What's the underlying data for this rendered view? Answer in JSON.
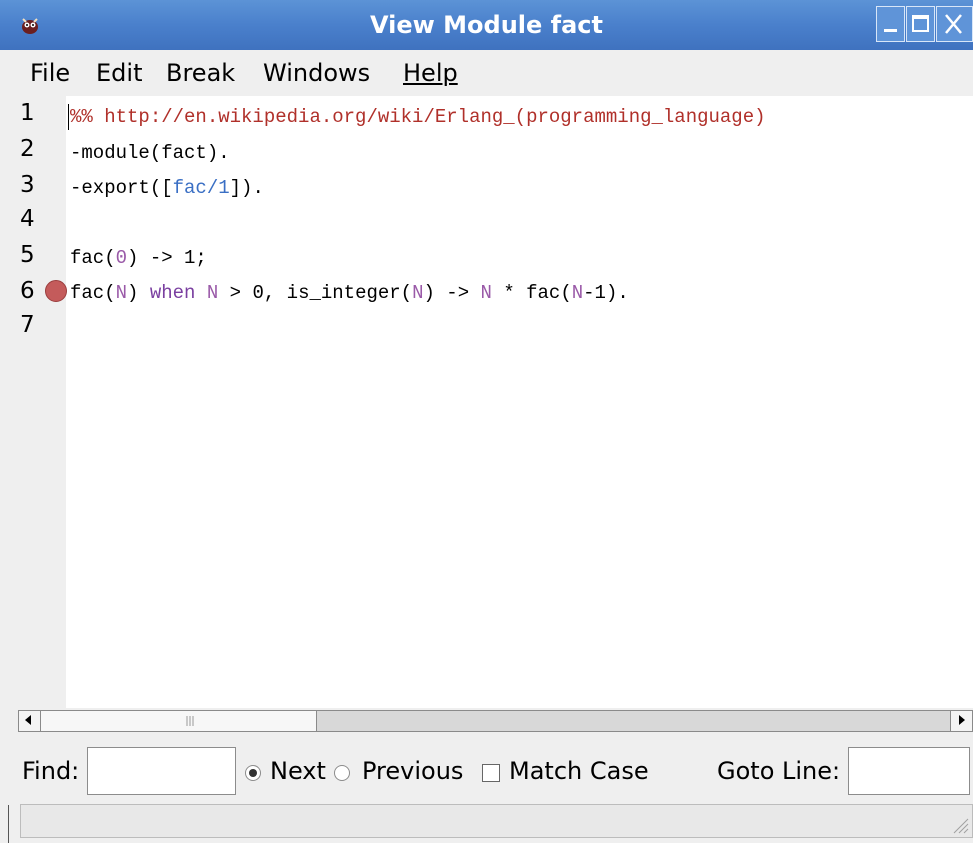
{
  "window": {
    "title": "View Module fact",
    "app_icon": "erlang-bug-icon",
    "controls": [
      "minimize-icon",
      "maximize-icon",
      "close-icon"
    ]
  },
  "menu": {
    "items": [
      "File",
      "Edit",
      "Break",
      "Windows",
      "Help"
    ]
  },
  "editor": {
    "line_numbers": [
      "1",
      "2",
      "3",
      "4",
      "5",
      "6",
      "7"
    ],
    "breakpoint_line": "6",
    "lines": [
      [
        {
          "t": "%% http://en.wikipedia.org/wiki/Erlang_(programming_language)",
          "c": "comment"
        }
      ],
      [
        {
          "t": "-module(fact).",
          "c": "plain"
        }
      ],
      [
        {
          "t": "-export([",
          "c": "plain"
        },
        {
          "t": "fac/1",
          "c": "atom"
        },
        {
          "t": "]).",
          "c": "plain"
        }
      ],
      [],
      [
        {
          "t": "fac(",
          "c": "plain"
        },
        {
          "t": "0",
          "c": "var"
        },
        {
          "t": ") -> 1;",
          "c": "plain"
        }
      ],
      [
        {
          "t": "fac(",
          "c": "plain"
        },
        {
          "t": "N",
          "c": "var"
        },
        {
          "t": ") ",
          "c": "plain"
        },
        {
          "t": "when",
          "c": "kw"
        },
        {
          "t": " ",
          "c": "plain"
        },
        {
          "t": "N",
          "c": "var"
        },
        {
          "t": " > 0, is_integer(",
          "c": "plain"
        },
        {
          "t": "N",
          "c": "var"
        },
        {
          "t": ") -> ",
          "c": "plain"
        },
        {
          "t": "N",
          "c": "var"
        },
        {
          "t": " * fac(",
          "c": "plain"
        },
        {
          "t": "N",
          "c": "var"
        },
        {
          "t": "-1).",
          "c": "plain"
        }
      ],
      []
    ],
    "colors": {
      "comment": "#b0302a",
      "var": "#9a5aa8",
      "kw": "#7a3fa0",
      "atom": "#3a6fc4",
      "breakpoint": "#c45b5b"
    }
  },
  "findbar": {
    "find_label": "Find:",
    "find_value": "",
    "next_label": "Next",
    "next_selected": true,
    "previous_label": "Previous",
    "previous_selected": false,
    "match_case_label": "Match Case",
    "match_case_checked": false,
    "goto_label": "Goto Line:",
    "goto_value": ""
  },
  "statusbar": {
    "text": ""
  }
}
